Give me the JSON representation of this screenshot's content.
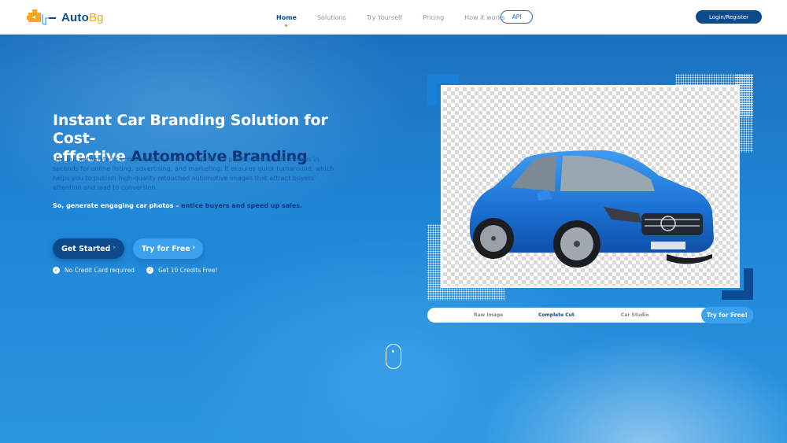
{
  "header": {
    "logo": {
      "text_primary": "Auto",
      "text_secondary": "Bg"
    },
    "nav": [
      {
        "label": "Home",
        "active": true
      },
      {
        "label": "Solutions",
        "active": false
      },
      {
        "label": "Try Yourself",
        "active": false
      },
      {
        "label": "Pricing",
        "active": false
      },
      {
        "label": "How it works",
        "active": false
      }
    ],
    "api_label": "API",
    "login_label": "Login/Register"
  },
  "hero": {
    "headline_line1": "Instant Car Branding Solution for Cost-",
    "headline_line2_plain": "effective ",
    "headline_line2_accent": "Automotive Branding",
    "description": "Use our automated car branding AI solution AutoBG, to professionally edit images in seconds for online listing, advertising, and marketing. It ensures quick turnaround, which helps you to publish high-quality retouched automotive images that attract buyers' attention and lead to conversion.",
    "tagline_plain": "So, generate engaging car photos – ",
    "tagline_accent": "entice buyers and speed up sales.",
    "get_started_label": "Get Started",
    "try_free_label": "Try for Free",
    "chevron": "›",
    "perks": [
      "No Credit Card required",
      "Get 10 Credits Free!"
    ],
    "check_glyph": "✓"
  },
  "preview": {
    "tabs": [
      {
        "label": "Raw Image",
        "active": false
      },
      {
        "label": "Complete Cut",
        "active": true
      },
      {
        "label": "Car Studio",
        "active": false
      }
    ],
    "try_label": "Try for Free!"
  },
  "colors": {
    "brand_dark": "#0d4a8c",
    "brand_light": "#3ba1ec",
    "accent_orange": "#f5a623",
    "active_dot": "#7ac142"
  }
}
